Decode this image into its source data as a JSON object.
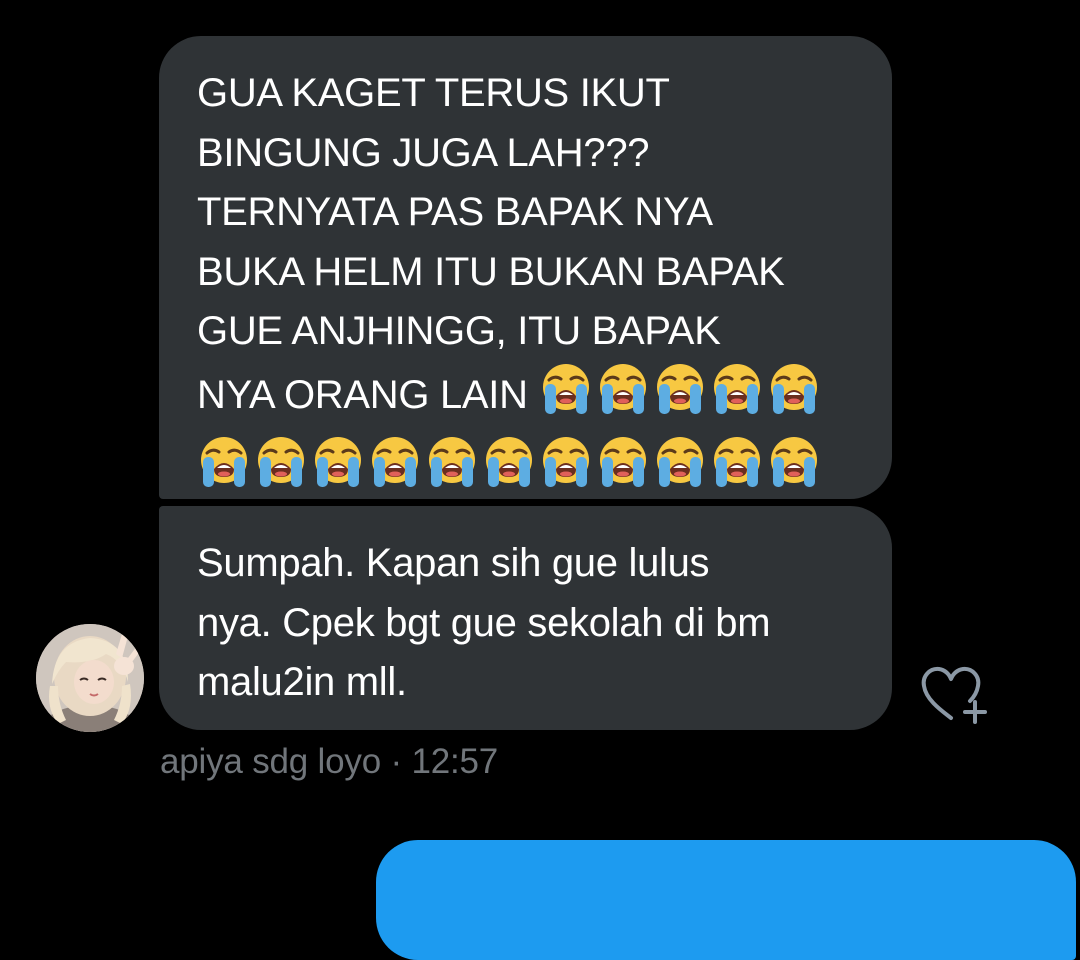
{
  "conversation": {
    "messages": [
      {
        "lines": [
          "GUA KAGET TERUS IKUT",
          "BINGUNG JUGA LAH???",
          "TERNYATA PAS BAPAK NYA",
          "BUKA HELM ITU BUKAN BAPAK",
          "GUE ANJHINGG, ITU BAPAK",
          "NYA ORANG LAIN"
        ],
        "emoji": "loudly-crying-face",
        "emoji_inline_count": 5,
        "emoji_row_count": 11
      },
      {
        "lines": [
          "Sumpah. Kapan sih gue lulus",
          "nya. Cpek bgt gue sekolah di bm",
          "malu2in mll."
        ]
      }
    ],
    "sender_name": "apiya sdg loyo",
    "separator": " · ",
    "time": "12:57"
  },
  "colors": {
    "background": "#000000",
    "bubble_received": "#2f3336",
    "bubble_sent": "#1d9bf0",
    "meta_text": "#71767b"
  },
  "icons": {
    "react": "heart-plus-icon",
    "avatar": "user-avatar"
  }
}
